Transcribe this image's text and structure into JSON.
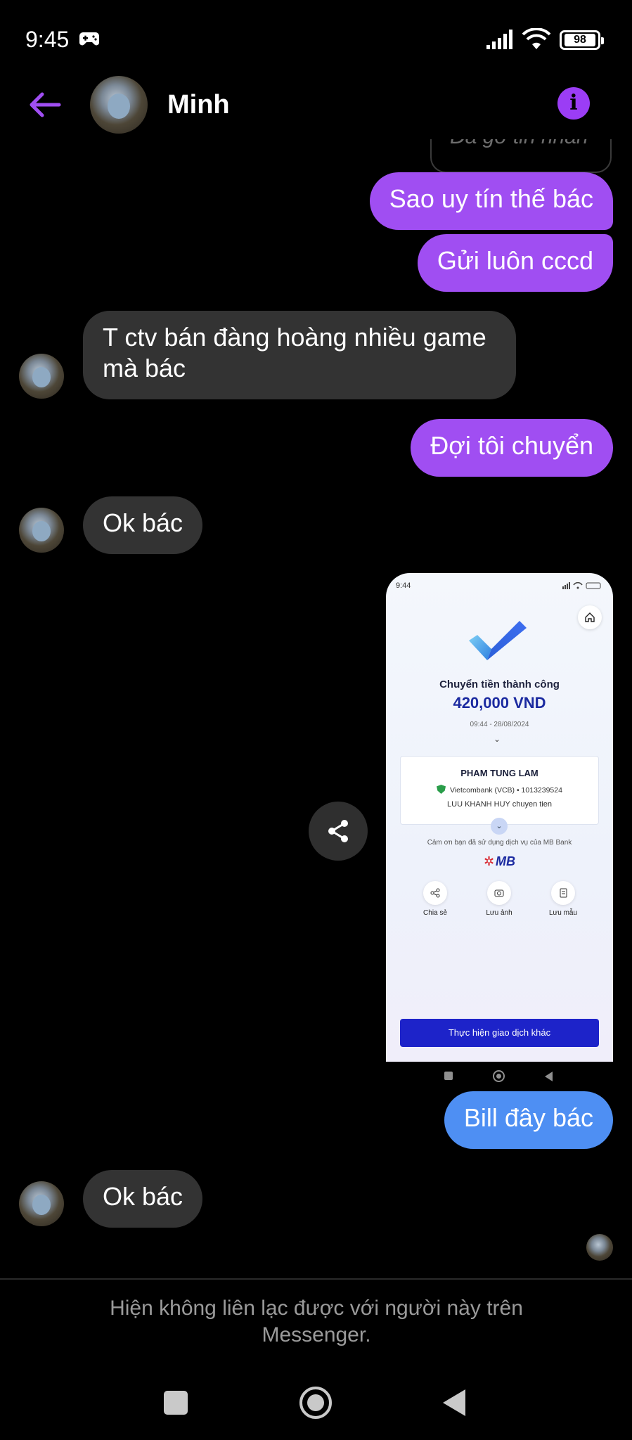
{
  "status_bar": {
    "time": "9:45",
    "battery": "98"
  },
  "header": {
    "contact_name": "Minh",
    "info_label": "i"
  },
  "deleted_fragment": "Đã gỡ tin nhắn",
  "messages": [
    {
      "direction": "out",
      "text": "Sao uy tín thế bác"
    },
    {
      "direction": "out",
      "text": "Gửi luôn cccd"
    },
    {
      "direction": "in",
      "text": "T ctv bán đàng hoàng nhiều game mà bác"
    },
    {
      "direction": "out",
      "text": "Đợi tôi chuyển"
    },
    {
      "direction": "in",
      "text": "Ok bác"
    },
    {
      "direction": "out",
      "text": "Bill đây bác"
    },
    {
      "direction": "in",
      "text": "Ok bác"
    }
  ],
  "receipt": {
    "time": "9:44",
    "title": "Chuyển tiền thành công",
    "amount": "420,000 VND",
    "datetime": "09:44 - 28/08/2024",
    "recipient_name": "PHAM TUNG LAM",
    "bank_line": "Vietcombank (VCB) • 1013239524",
    "note": "LUU KHANH HUY chuyen tien",
    "thanks": "Cảm ơn bạn đã sử dụng dịch vụ của MB Bank",
    "logo": "MB",
    "actions": [
      "Chia sẻ",
      "Lưu ảnh",
      "Lưu mẫu"
    ],
    "cta": "Thực hiện giao dịch khác"
  },
  "footer": {
    "note": "Hiện không liên lạc được với người này trên Messenger."
  },
  "colors": {
    "outgoing_bubble": "#a04ef2",
    "outgoing_bubble_blue": "#4e8ff3",
    "incoming_bubble": "#333333",
    "accent": "#9b3df5"
  }
}
